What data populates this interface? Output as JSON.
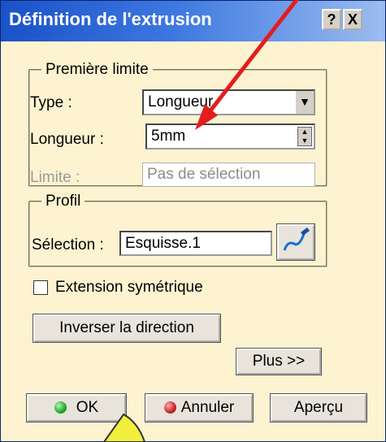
{
  "window": {
    "title": "Définition de l'extrusion",
    "help_label": "?",
    "close_label": "X"
  },
  "first_limit": {
    "legend": "Première limite",
    "type_label": "Type :",
    "type_value": "Longueur",
    "length_label": "Longueur :",
    "length_value": "5mm",
    "limit_label": "Limite :",
    "limit_value": "Pas de sélection"
  },
  "profile": {
    "legend": "Profil",
    "selection_label": "Sélection :",
    "selection_value": "Esquisse.1"
  },
  "options": {
    "symmetric_label": "Extension symétrique",
    "symmetric_checked": false,
    "reverse_label": "Inverser la direction",
    "more_label": "Plus >>"
  },
  "footer": {
    "ok_label": "OK",
    "cancel_label": "Annuler",
    "preview_label": "Aperçu"
  },
  "colors": {
    "dialog_bg": "#fdf3d0",
    "ok_dot": "#22aa22",
    "cancel_dot": "#cc2222",
    "annotation_arrow": "#e51c1c",
    "cursor_fill": "#f2ee3c"
  }
}
